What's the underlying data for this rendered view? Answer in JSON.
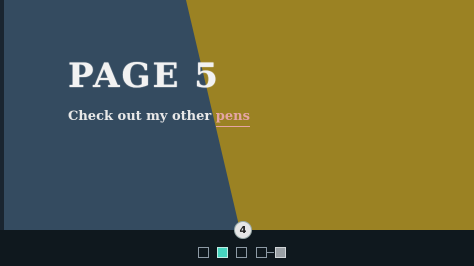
{
  "slide": {
    "title": "PAGE 5",
    "subtitle_prefix": "Check out my other ",
    "subtitle_link": "pens"
  },
  "pager": {
    "current_label": "4",
    "dots": [
      {
        "name": "pager-dot-1",
        "state": "empty"
      },
      {
        "name": "pager-dot-2",
        "state": "active"
      },
      {
        "name": "pager-dot-3",
        "state": "empty"
      },
      {
        "name": "pager-dot-4",
        "state": "empty"
      },
      {
        "name": "pager-dot-5",
        "state": "filled"
      }
    ]
  },
  "colors": {
    "left_panel": "#344b60",
    "right_panel": "#9b8223",
    "footer": "#0f181e",
    "link": "#e5a5a5",
    "active_dot": "#46d4bf"
  }
}
